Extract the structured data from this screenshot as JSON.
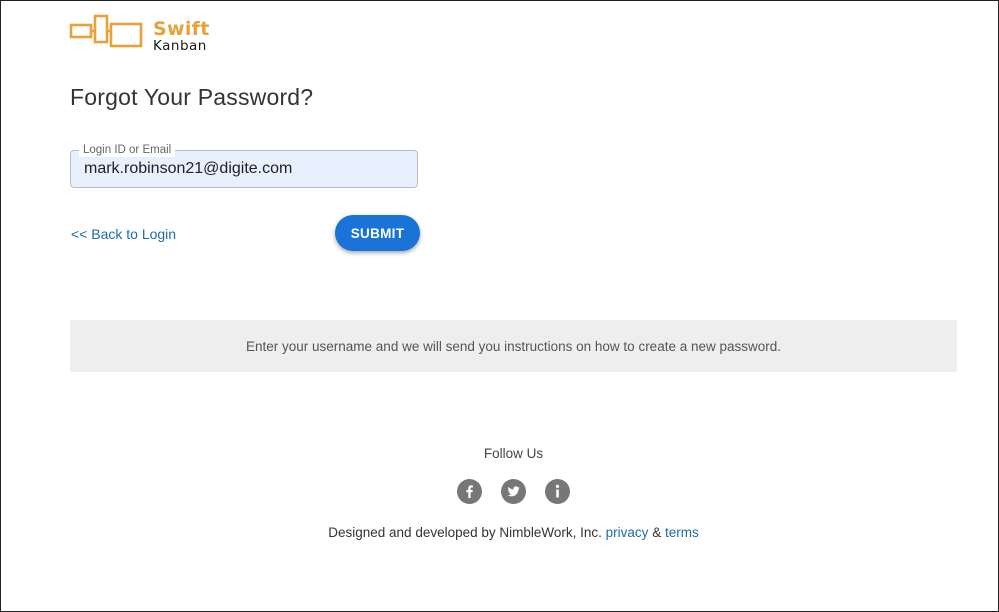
{
  "brand": {
    "word1": "Swift",
    "word2": "Kanban",
    "accent_color": "#e8a23a"
  },
  "page_title": "Forgot Your Password?",
  "login_field": {
    "label": "Login ID or Email",
    "value": "mark.robinson21@digite.com"
  },
  "back_link": "<< Back to Login",
  "submit_label": "SUBMIT",
  "submit_color": "#1a73d6",
  "info_text": "Enter your username and we will send you instructions on how to create a new password.",
  "follow_us": "Follow Us",
  "socials": [
    {
      "icon": "facebook-icon"
    },
    {
      "icon": "twitter-icon"
    },
    {
      "icon": "info-icon"
    }
  ],
  "footer": {
    "credit": "Designed and developed by NimbleWork, Inc.",
    "privacy": "privacy",
    "ampersand": "&",
    "terms": "terms"
  }
}
